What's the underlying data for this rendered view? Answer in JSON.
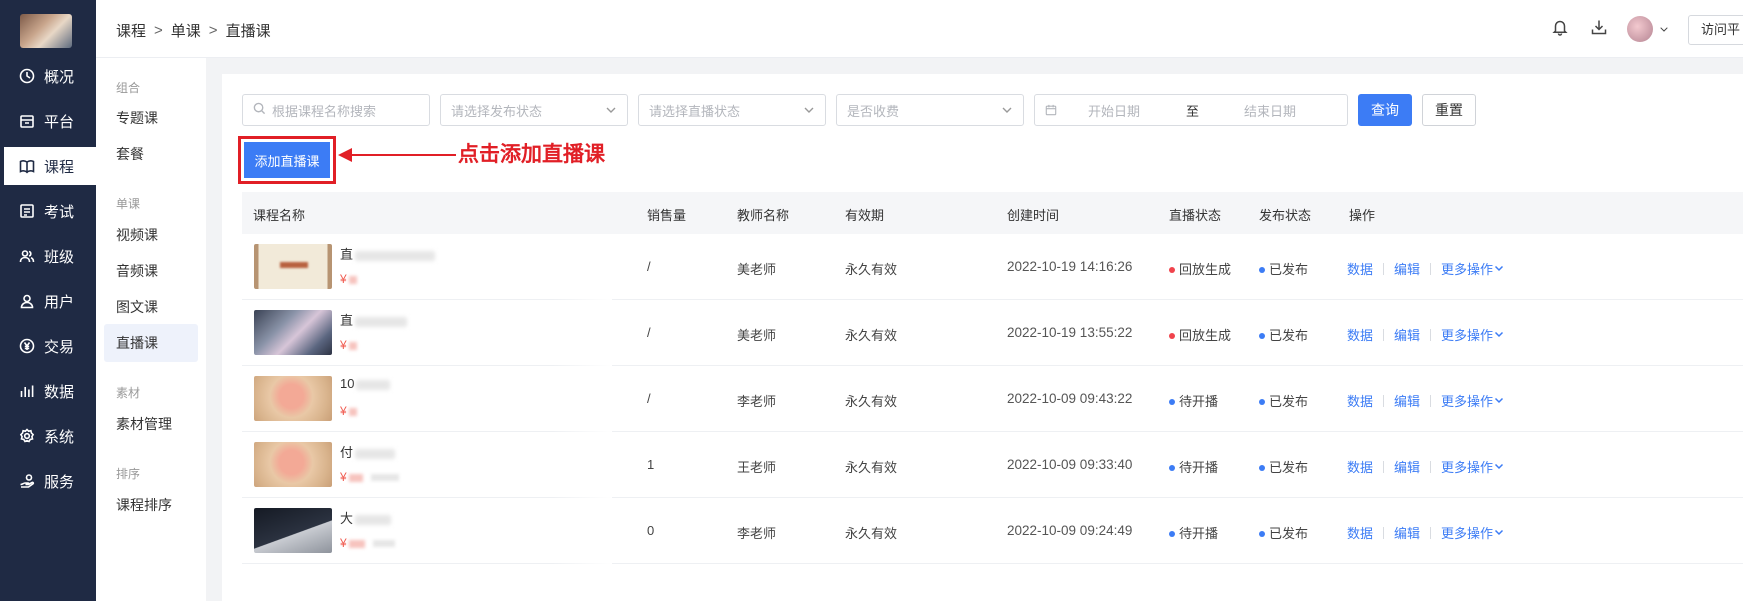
{
  "nav": {
    "items": [
      {
        "label": "概况",
        "icon": "clock-icon"
      },
      {
        "label": "平台",
        "icon": "store-icon"
      },
      {
        "label": "课程",
        "icon": "book-icon"
      },
      {
        "label": "考试",
        "icon": "exam-icon"
      },
      {
        "label": "班级",
        "icon": "group-icon"
      },
      {
        "label": "用户",
        "icon": "user-icon"
      },
      {
        "label": "交易",
        "icon": "yen-icon"
      },
      {
        "label": "数据",
        "icon": "bar-chart-icon"
      },
      {
        "label": "系统",
        "icon": "gear-icon"
      },
      {
        "label": "服务",
        "icon": "service-icon"
      }
    ],
    "active": "课程"
  },
  "breadcrumb": {
    "items": [
      "课程",
      "单课",
      "直播课"
    ],
    "separator": ">"
  },
  "header": {
    "visit_label": "访问平"
  },
  "subnav": {
    "groups": [
      {
        "title": "组合",
        "items": [
          "专题课",
          "套餐"
        ]
      },
      {
        "title": "单课",
        "items": [
          "视频课",
          "音频课",
          "图文课",
          "直播课"
        ]
      },
      {
        "title": "素材",
        "items": [
          "素材管理"
        ]
      },
      {
        "title": "排序",
        "items": [
          "课程排序"
        ]
      }
    ],
    "active": "直播课"
  },
  "filters": {
    "search_placeholder": "根据课程名称搜索",
    "publish_status_placeholder": "请选择发布状态",
    "live_status_placeholder": "请选择直播状态",
    "charge_placeholder": "是否收费",
    "start_date_placeholder": "开始日期",
    "date_separator": "至",
    "end_date_placeholder": "结束日期",
    "query_label": "查询",
    "reset_label": "重置"
  },
  "add_button_label": "添加直播课",
  "annotation_text": "点击添加直播课",
  "colors": {
    "accent": "#3c7cf5",
    "sidebar": "#1f2a44",
    "annotation": "#e11f26",
    "status_red": "#f0434c",
    "status_blue": "#3c7cf5"
  },
  "table": {
    "columns": [
      "课程名称",
      "销售量",
      "教师名称",
      "有效期",
      "创建时间",
      "直播状态",
      "发布状态",
      "操作"
    ],
    "rows": [
      {
        "name": "直",
        "price": "¥",
        "sales": "/",
        "teacher": "美老师",
        "validity": "永久有效",
        "created": "2022-10-19 14:16:26",
        "live_status": "回放生成",
        "live_color": "red",
        "publish_status": "已发布",
        "thumb": "certificate"
      },
      {
        "name": "直",
        "price": "¥",
        "sales": "/",
        "teacher": "美老师",
        "validity": "永久有效",
        "created": "2022-10-19 13:55:22",
        "live_status": "回放生成",
        "live_color": "red",
        "publish_status": "已发布",
        "thumb": "photo"
      },
      {
        "name": "10",
        "price": "¥",
        "sales": "/",
        "teacher": "李老师",
        "validity": "永久有效",
        "created": "2022-10-09 09:43:22",
        "live_status": "待开播",
        "live_color": "blue",
        "publish_status": "已发布",
        "thumb": "flower"
      },
      {
        "name": "付",
        "price": "¥",
        "sales": "1",
        "teacher": "王老师",
        "validity": "永久有效",
        "created": "2022-10-09 09:33:40",
        "live_status": "待开播",
        "live_color": "blue",
        "publish_status": "已发布",
        "thumb": "flower"
      },
      {
        "name": "大",
        "price": "¥",
        "sales": "0",
        "teacher": "李老师",
        "validity": "永久有效",
        "created": "2022-10-09 09:24:49",
        "live_status": "待开播",
        "live_color": "blue",
        "publish_status": "已发布",
        "thumb": "dark"
      }
    ],
    "ops": {
      "data": "数据",
      "edit": "编辑",
      "more": "更多操作"
    }
  }
}
